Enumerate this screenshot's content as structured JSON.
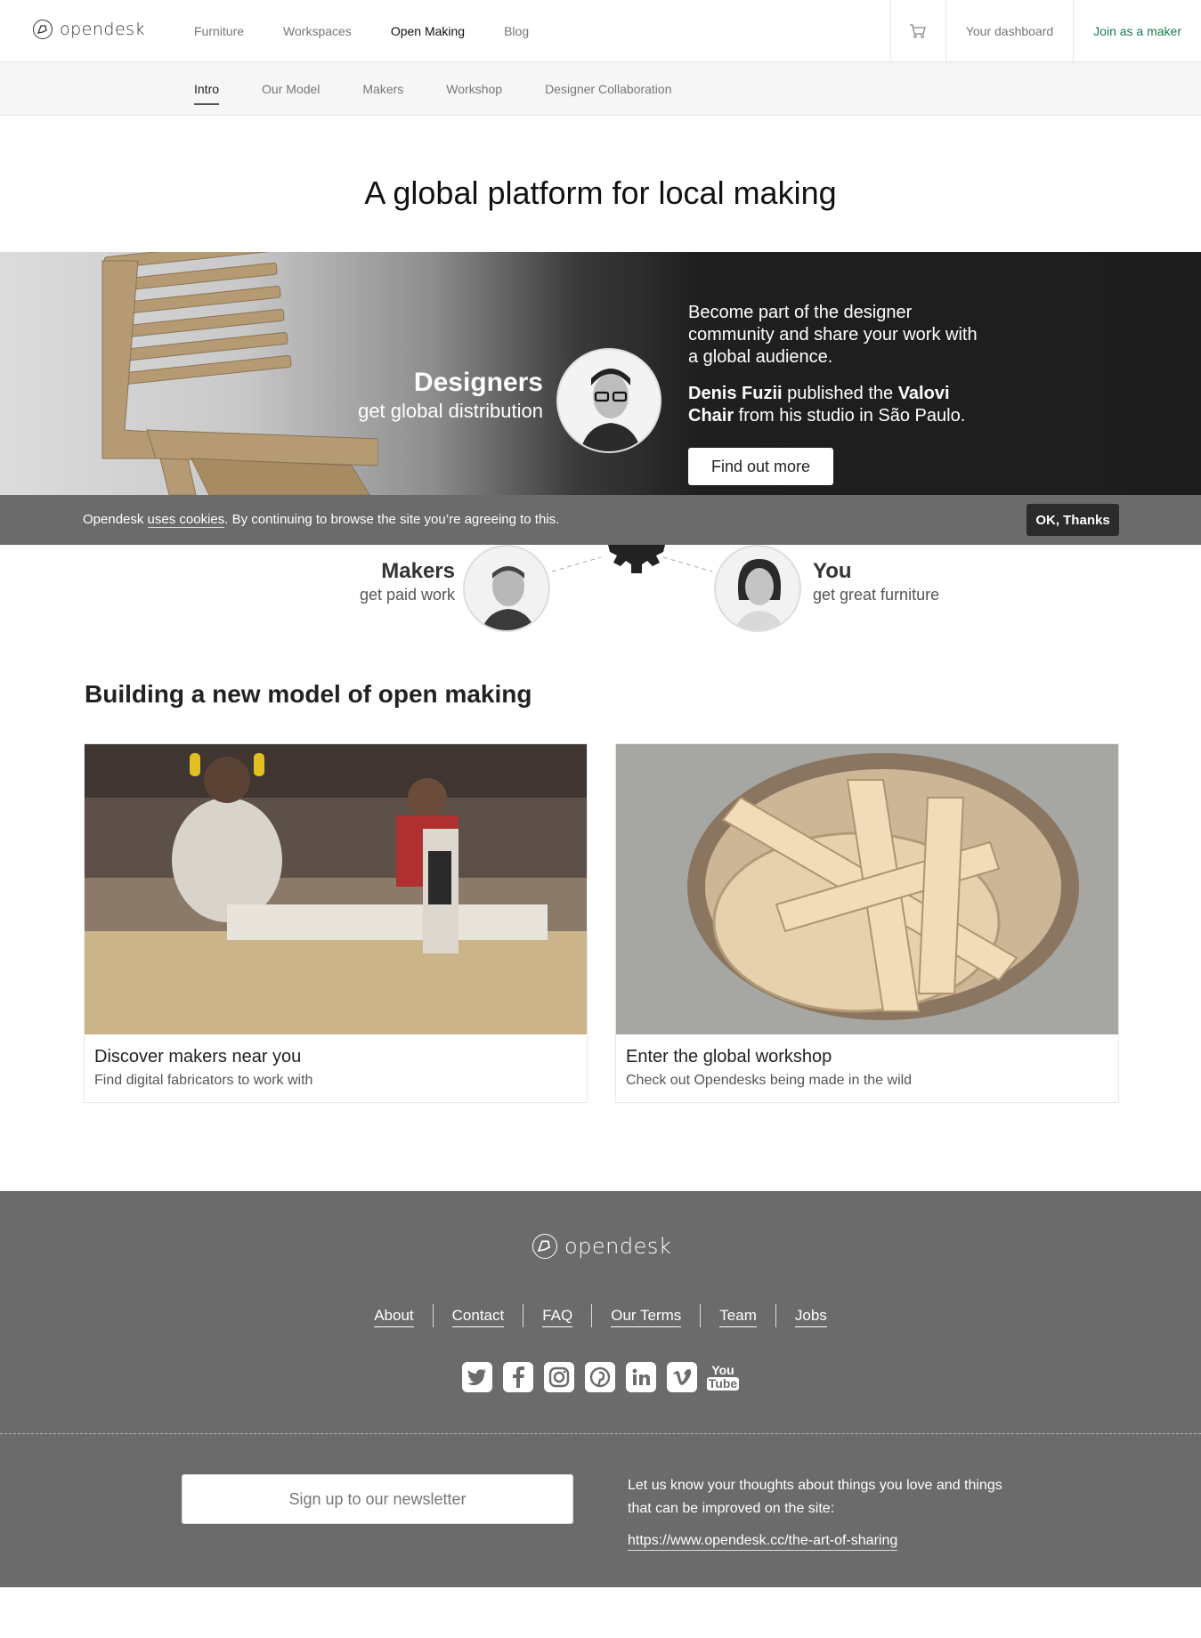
{
  "header": {
    "logo_text": "opendesk",
    "nav": [
      "Furniture",
      "Workspaces",
      "Open Making",
      "Blog"
    ],
    "active_nav": "Open Making",
    "dashboard_label": "Your dashboard",
    "join_label": "Join as a maker"
  },
  "subnav": {
    "items": [
      "Intro",
      "Our Model",
      "Makers",
      "Workshop",
      "Designer Collaboration"
    ],
    "active": "Intro"
  },
  "hero": {
    "title": "A global platform for local making"
  },
  "banner": {
    "heading": "Designers",
    "subheading": "get global distribution",
    "intro": "Become part of the designer community and share your work with a global audience.",
    "story_name": "Denis Fuzii",
    "story_mid": " published the ",
    "story_product": "Valovi Chair",
    "story_end": " from his studio in São Paulo.",
    "button": "Find out more"
  },
  "cookie": {
    "text_before": "Opendesk ",
    "link": "uses cookies",
    "text_after": ". By continuing to browse the site you’re agreeing to this.",
    "button": "OK, Thanks"
  },
  "diagram": {
    "makers_title": "Makers",
    "makers_sub": "get paid work",
    "you_title": "You",
    "you_sub": "get great furniture"
  },
  "section": {
    "title": "Building a new model of open making",
    "cards": [
      {
        "title": "Discover makers near you",
        "subtitle": "Find digital fabricators to work with"
      },
      {
        "title": "Enter the global workshop",
        "subtitle": "Check out Opendesks being made in the wild"
      }
    ]
  },
  "footer": {
    "logo_text": "opendesk",
    "links": [
      "About",
      "Contact",
      "FAQ",
      "Our Terms",
      "Team",
      "Jobs"
    ],
    "social": [
      "twitter-icon",
      "facebook-icon",
      "instagram-icon",
      "pinterest-icon",
      "linkedin-icon",
      "vimeo-icon",
      "youtube-icon"
    ],
    "youtube_top": "You",
    "youtube_bottom": "Tube",
    "newsletter_label": "Sign up to our newsletter",
    "feedback_text": "Let us know your thoughts about things you love and things that can be improved on the site:",
    "feedback_link": "https://www.opendesk.cc/the-art-of-sharing"
  },
  "colors": {
    "accent_green": "#1b7a4d",
    "footer_bg": "#6b6b6b",
    "banner_dark": "#1d1d1d"
  }
}
